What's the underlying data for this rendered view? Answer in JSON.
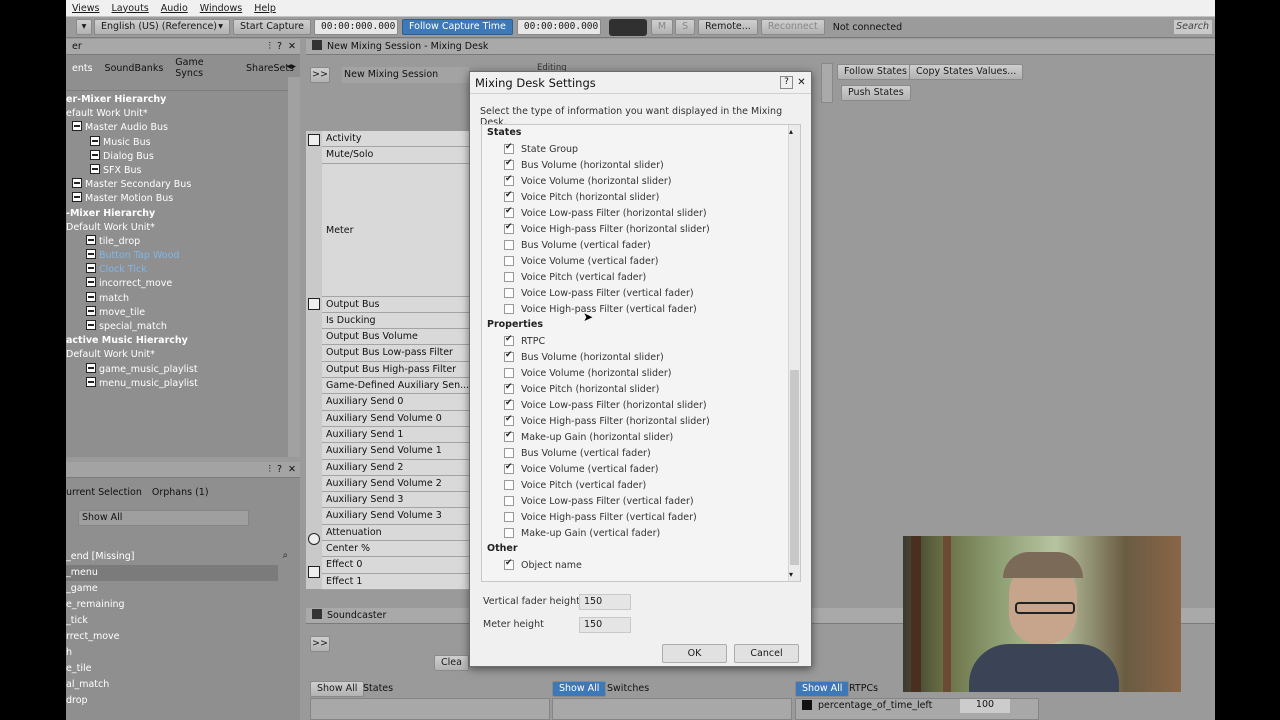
{
  "menu": {
    "items": [
      "Views",
      "Layouts",
      "Audio",
      "Windows",
      "Help"
    ]
  },
  "toolbar": {
    "language": "English (US) (Reference)",
    "start_capture": "Start Capture",
    "time1": "00:00:000.000",
    "follow_capture": "Follow Capture Time",
    "time2": "00:00:000.000",
    "m": "M",
    "s": "S",
    "remote": "Remote...",
    "reconnect": "Reconnect",
    "status": "Not connected",
    "search": "Search"
  },
  "left_panel": {
    "title": "er",
    "tabs": [
      "ents",
      "SoundBanks",
      "Game Syncs",
      "ShareSets"
    ],
    "tree": [
      {
        "t": "er-Mixer Hierarchy",
        "h": true
      },
      {
        "t": "efault Work Unit*",
        "x": 0
      },
      {
        "t": "Master Audio Bus",
        "x": 6,
        "i": true
      },
      {
        "t": "Music Bus",
        "x": 24,
        "i": true
      },
      {
        "t": "Dialog Bus",
        "x": 24,
        "i": true
      },
      {
        "t": "SFX Bus",
        "x": 24,
        "i": true
      },
      {
        "t": "Master Secondary Bus",
        "x": 6,
        "i": true
      },
      {
        "t": "Master Motion Bus",
        "x": 6,
        "i": true
      },
      {
        "t": "-Mixer Hierarchy",
        "h": true
      },
      {
        "t": "Default Work Unit*",
        "x": 0
      },
      {
        "t": "tile_drop",
        "x": 20,
        "i": true
      },
      {
        "t": "Button Tap Wood",
        "x": 20,
        "i": true,
        "sel": true
      },
      {
        "t": "Clock Tick",
        "x": 20,
        "i": true,
        "sel": true
      },
      {
        "t": "incorrect_move",
        "x": 20,
        "i": true
      },
      {
        "t": "match",
        "x": 20,
        "i": true
      },
      {
        "t": "move_tile",
        "x": 20,
        "i": true
      },
      {
        "t": "special_match",
        "x": 20,
        "i": true
      },
      {
        "t": "active Music Hierarchy",
        "h": true
      },
      {
        "t": "Default Work Unit*",
        "x": 0
      },
      {
        "t": "game_music_playlist",
        "x": 20,
        "i": true
      },
      {
        "t": "menu_music_playlist",
        "x": 20,
        "i": true
      }
    ]
  },
  "bottom_left": {
    "tabs": [
      "urrent Selection",
      "Orphans (1)"
    ],
    "filter": "Show All",
    "items": [
      "_end [Missing]",
      "_menu",
      "_game",
      "e_remaining",
      "_tick",
      "rrect_move",
      "h",
      "e_tile",
      "al_match",
      "drop"
    ]
  },
  "mixing_desk": {
    "title": "New Mixing Session - Mixing Desk",
    "session": "New Mixing Session",
    "editing": "Editing",
    "follow_states": "Follow States",
    "copy_states": "Copy States Values...",
    "push_states": "Push States",
    "rows": [
      "Activity",
      "Mute/Solo",
      "Meter",
      "Output Bus",
      "Is Ducking",
      "Output Bus Volume",
      "Output Bus Low-pass Filter",
      "Output Bus High-pass Filter",
      "Game-Defined Auxiliary Sen...",
      "Auxiliary Send 0",
      "Auxiliary Send Volume 0",
      "Auxiliary Send 1",
      "Auxiliary Send Volume 1",
      "Auxiliary Send 2",
      "Auxiliary Send Volume 2",
      "Auxiliary Send 3",
      "Auxiliary Send Volume 3",
      "Attenuation",
      "Center %",
      "Effect 0",
      "Effect 1"
    ]
  },
  "soundcaster": {
    "title": "Soundcaster",
    "clear": "Clea",
    "show_all": "Show All",
    "states": "States",
    "switches": "Switches",
    "rtpcs": "RTPCs",
    "rtpc_name": "percentage_of_time_left",
    "rtpc_value": "100"
  },
  "dialog": {
    "title": "Mixing Desk Settings",
    "help": "?",
    "close": "✕",
    "desc": "Select the type of information you want displayed in the Mixing Desk.",
    "sections": [
      {
        "name": "States",
        "options": [
          {
            "l": "State Group",
            "c": true
          },
          {
            "l": "Bus Volume (horizontal slider)",
            "c": true
          },
          {
            "l": "Voice Volume (horizontal slider)",
            "c": true
          },
          {
            "l": "Voice Pitch (horizontal slider)",
            "c": true
          },
          {
            "l": "Voice Low-pass Filter (horizontal slider)",
            "c": true
          },
          {
            "l": "Voice High-pass Filter (horizontal slider)",
            "c": true
          },
          {
            "l": "Bus Volume (vertical fader)",
            "c": false
          },
          {
            "l": "Voice Volume (vertical fader)",
            "c": false
          },
          {
            "l": "Voice Pitch (vertical fader)",
            "c": false
          },
          {
            "l": "Voice Low-pass Filter (vertical fader)",
            "c": false
          },
          {
            "l": "Voice High-pass Filter (vertical fader)",
            "c": false
          }
        ]
      },
      {
        "name": "Properties",
        "options": [
          {
            "l": "RTPC",
            "c": true
          },
          {
            "l": "Bus Volume (horizontal slider)",
            "c": true
          },
          {
            "l": "Voice Volume (horizontal slider)",
            "c": false
          },
          {
            "l": "Voice Pitch (horizontal slider)",
            "c": true
          },
          {
            "l": "Voice Low-pass Filter (horizontal slider)",
            "c": true
          },
          {
            "l": "Voice High-pass Filter (horizontal slider)",
            "c": true
          },
          {
            "l": "Make-up Gain (horizontal slider)",
            "c": true
          },
          {
            "l": "Bus Volume (vertical fader)",
            "c": false
          },
          {
            "l": "Voice Volume (vertical fader)",
            "c": true
          },
          {
            "l": "Voice Pitch (vertical fader)",
            "c": false
          },
          {
            "l": "Voice Low-pass Filter (vertical fader)",
            "c": false
          },
          {
            "l": "Voice High-pass Filter (vertical fader)",
            "c": false
          },
          {
            "l": "Make-up Gain (vertical fader)",
            "c": false
          }
        ]
      },
      {
        "name": "Other",
        "options": [
          {
            "l": "Object name",
            "c": true
          }
        ]
      }
    ],
    "fader_label": "Vertical fader height",
    "fader_value": "150",
    "meter_label": "Meter height",
    "meter_value": "150",
    "ok": "OK",
    "cancel": "Cancel"
  }
}
